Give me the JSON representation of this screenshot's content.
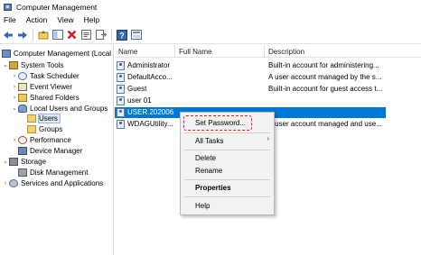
{
  "window": {
    "title": "Computer Management"
  },
  "menu": [
    "File",
    "Action",
    "View",
    "Help"
  ],
  "toolbar": {
    "buttons": [
      "back-arrow-icon",
      "forward-arrow-icon",
      "up-folder-icon",
      "show-hide-tree-icon",
      "delete-icon",
      "properties-icon",
      "export-list-icon",
      "help-icon",
      "view-icon"
    ]
  },
  "tree": {
    "root": "Computer Management (Local",
    "system_tools": "System Tools",
    "task_scheduler": "Task Scheduler",
    "event_viewer": "Event Viewer",
    "shared_folders": "Shared Folders",
    "local_users_groups": "Local Users and Groups",
    "users": "Users",
    "groups": "Groups",
    "performance": "Performance",
    "device_manager": "Device Manager",
    "storage": "Storage",
    "disk_management": "Disk Management",
    "services_apps": "Services and Applications"
  },
  "list": {
    "columns": [
      "Name",
      "Full Name",
      "Description"
    ],
    "rows": [
      {
        "name": "Administrator",
        "full_name": "",
        "description": "Built-in account for administering..."
      },
      {
        "name": "DefaultAcco...",
        "full_name": "",
        "description": "A user account managed by the s..."
      },
      {
        "name": "Guest",
        "full_name": "",
        "description": "Built-in account for guest access t..."
      },
      {
        "name": "user 01",
        "full_name": "",
        "description": ""
      },
      {
        "name": "USER.202006...",
        "full_name": "",
        "description": ""
      },
      {
        "name": "WDAGUtility...",
        "full_name": "",
        "description": "A user account managed and use..."
      }
    ]
  },
  "context_menu": {
    "set_password": "Set Password...",
    "all_tasks": "All Tasks",
    "delete": "Delete",
    "rename": "Rename",
    "properties": "Properties",
    "help": "Help",
    "submenu_arrow": "›"
  },
  "colors": {
    "selection": "#0078d7",
    "highlight_box": "#e02020"
  }
}
